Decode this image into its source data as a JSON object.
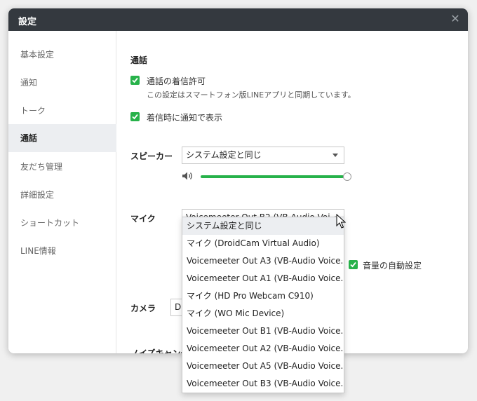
{
  "window": {
    "title": "設定"
  },
  "sidebar": {
    "items": [
      {
        "label": "基本設定"
      },
      {
        "label": "通知"
      },
      {
        "label": "トーク"
      },
      {
        "label": "通話"
      },
      {
        "label": "友だち管理"
      },
      {
        "label": "詳細設定"
      },
      {
        "label": "ショートカット"
      },
      {
        "label": "LINE情報"
      }
    ],
    "active": "通話"
  },
  "content": {
    "section_title": "通話",
    "allow_incoming": {
      "label": "通話の着信許可",
      "checked": true,
      "note": "この設定はスマートフォン版LINEアプリと同期しています。"
    },
    "show_notification": {
      "label": "着信時に通知で表示",
      "checked": true
    },
    "speaker": {
      "label": "スピーカー",
      "value": "システム設定と同じ",
      "volume_fraction": 0.93
    },
    "mic": {
      "label": "マイク",
      "value": "Voicemeeter Out B2 (VB-Audio Voi..."
    },
    "auto_volume": {
      "label": "音量の自動設定",
      "checked": true
    },
    "camera": {
      "label": "カメラ",
      "value": "Dr"
    },
    "noise_cancel": {
      "label": "ノイズキャンセリ"
    }
  },
  "mic_dropdown": {
    "options": [
      "システム設定と同じ",
      "マイク (DroidCam Virtual Audio)",
      "Voicemeeter Out A3 (VB-Audio Voice...",
      "Voicemeeter Out A1 (VB-Audio Voice...",
      "マイク (HD Pro Webcam C910)",
      "マイク (WO Mic Device)",
      "Voicemeeter Out B1 (VB-Audio Voice...",
      "Voicemeeter Out A2 (VB-Audio Voice...",
      "Voicemeeter Out A5 (VB-Audio Voice...",
      "Voicemeeter Out B3 (VB-Audio Voice..."
    ],
    "highlighted_index": 0
  },
  "colors": {
    "accent": "#27b24a",
    "titlebar": "#34393f",
    "active_bg": "#eceef1"
  }
}
